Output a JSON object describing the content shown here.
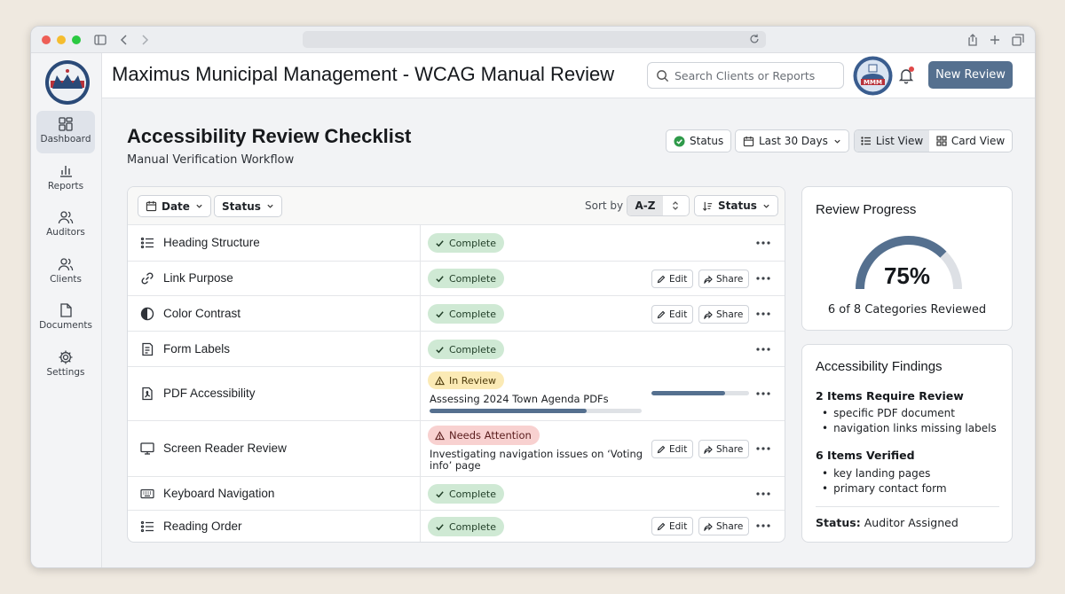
{
  "app": {
    "title": "Maximus Municipal Management - WCAG Manual Review",
    "search_placeholder": "Search Clients or Reports",
    "new_review_label": "New Review",
    "logo_text": "MMM"
  },
  "sidebar": {
    "items": [
      {
        "label": "Dashboard",
        "icon": "dashboard-icon",
        "active": true
      },
      {
        "label": "Reports",
        "icon": "bar-chart-icon"
      },
      {
        "label": "Auditors",
        "icon": "users-icon"
      },
      {
        "label": "Clients",
        "icon": "user-group-icon"
      },
      {
        "label": "Documents",
        "icon": "document-icon"
      },
      {
        "label": "Settings",
        "icon": "gear-icon"
      }
    ]
  },
  "page": {
    "title": "Accessibility Review Checklist",
    "subtitle": "Manual Verification Workflow",
    "status_button": "Status",
    "date_range": "Last 30 Days",
    "view_list": "List View",
    "view_card": "Card View",
    "active_view": "list"
  },
  "toolbar": {
    "date_filter": "Date",
    "status_filter": "Status",
    "sort_by_label": "Sort by",
    "sort_value": "A-Z",
    "status_sort": "Status"
  },
  "actions": {
    "edit": "Edit",
    "share": "Share"
  },
  "checklist": [
    {
      "name": "Heading Structure",
      "icon": "list-icon",
      "status": "Complete",
      "type": "ok"
    },
    {
      "name": "Link Purpose",
      "icon": "link-icon",
      "status": "Complete",
      "type": "ok"
    },
    {
      "name": "Color Contrast",
      "icon": "contrast-icon",
      "status": "Complete",
      "type": "ok"
    },
    {
      "name": "Form Labels",
      "icon": "form-icon",
      "status": "Complete",
      "type": "ok"
    },
    {
      "name": "PDF Accessibility",
      "icon": "pdf-icon",
      "status": "In Review",
      "type": "rev",
      "note": "Assessing 2024 Town Agenda PDFs",
      "progress": 0.75,
      "progress2": 0.74
    },
    {
      "name": "Screen Reader Review",
      "icon": "monitor-icon",
      "status": "Needs Attention",
      "type": "att",
      "note_line1": "Investigating navigation issues on ‘Voting",
      "note_line2": "info’ page"
    },
    {
      "name": "Keyboard Navigation",
      "icon": "keyboard-icon",
      "status": "Complete",
      "type": "ok"
    },
    {
      "name": "Reading Order",
      "icon": "ordered-list-icon",
      "status": "Complete",
      "type": "ok"
    }
  ],
  "progress_card": {
    "title": "Review Progress",
    "percent": 75,
    "percent_text": "75%",
    "summary": "6 of 8 Categories Reviewed"
  },
  "findings": {
    "title": "Accessibility Findings",
    "review_heading": "2 Items Require Review",
    "review_items": [
      "specific PDF document",
      "navigation links missing labels"
    ],
    "verified_heading": "6 Items Verified",
    "verified_items": [
      "key landing pages",
      "primary contact form"
    ],
    "status_label": "Status:",
    "status_value": "Auditor Assigned"
  },
  "colors": {
    "accent": "#55708f",
    "complete": "#cfe9d4",
    "in_review": "#fbeab5",
    "attention": "#f8d1d0"
  }
}
